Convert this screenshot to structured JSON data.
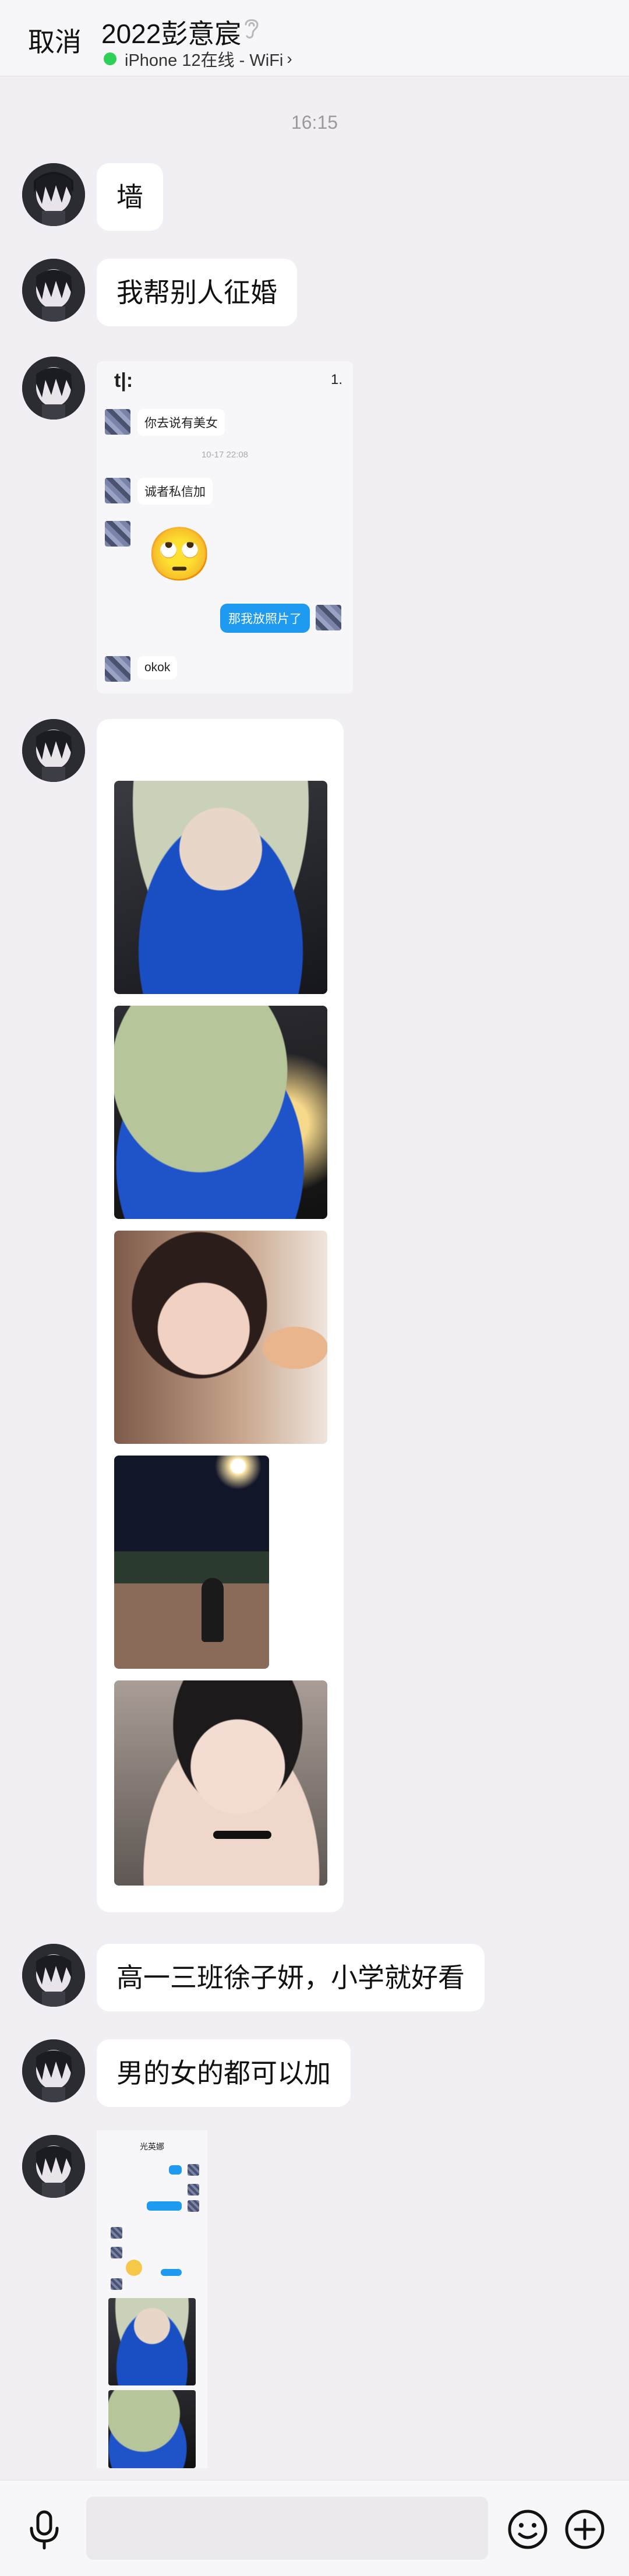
{
  "header": {
    "cancel_label": "取消",
    "title": "2022彭意宸",
    "status": "iPhone 12在线 - WiFi",
    "status_color": "#2fd058",
    "ear_icon": "hearing-icon"
  },
  "timestamp": "16:15",
  "messages": [
    {
      "type": "text",
      "text": "墙"
    },
    {
      "type": "text",
      "text": "我帮别人征婚"
    },
    {
      "type": "screenshot",
      "status_left": "t|:",
      "status_right": "1.",
      "lines": [
        {
          "side": "left",
          "text": "你去说有美女"
        },
        {
          "side": "time",
          "text": "10-17 22:08"
        },
        {
          "side": "left",
          "text": "诚者私信加"
        },
        {
          "side": "left",
          "emoji": "🙄"
        },
        {
          "side": "right",
          "text": "那我放照片了"
        },
        {
          "side": "left",
          "text": "okok"
        }
      ]
    },
    {
      "type": "images",
      "count": 5
    },
    {
      "type": "text",
      "text": "高一三班徐子妍，小学就好看"
    },
    {
      "type": "text",
      "text": "男的女的都可以加"
    },
    {
      "type": "screenshot_small",
      "title": "光英娜"
    }
  ],
  "bottom_bar": {
    "mic_icon": "microphone-icon",
    "emoji_icon": "smiley-icon",
    "plus_icon": "plus-circle-icon",
    "accent": "#111111"
  }
}
